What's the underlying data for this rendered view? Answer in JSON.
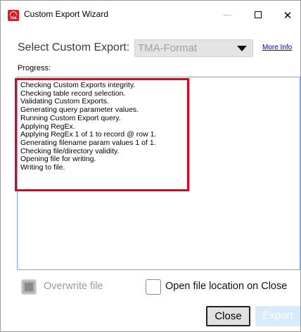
{
  "window": {
    "title": "Custom Export Wizard",
    "icon_name": "app-logo-icon",
    "icon_text": "TOA",
    "controls": {
      "minimize": "—",
      "close": "✕"
    }
  },
  "select": {
    "label": "Select Custom Export:",
    "value": "TMA-Format",
    "more_info": "More Info"
  },
  "progress": {
    "label": "Progress:",
    "log": [
      "Checking Custom Exports integrity.",
      "Checking table record selection.",
      "Validating Custom Exports.",
      "Generating query parameter values.",
      "Running Custom Export query.",
      "Applying RegEx.",
      "Applying RegEx 1 of 1 to record @ row 1.",
      "Generating filename param values 1 of 1.",
      "Checking file/directory validity.",
      "Opening file for writing.",
      "Writing to file."
    ]
  },
  "options": {
    "overwrite_label": "Overwrite file",
    "open_location_label": "Open file location on Close"
  },
  "buttons": {
    "close": "Close",
    "export": "Export"
  },
  "colors": {
    "highlight": "#e3001b",
    "accent_border": "#7aa8e0",
    "link": "#0000cc"
  }
}
